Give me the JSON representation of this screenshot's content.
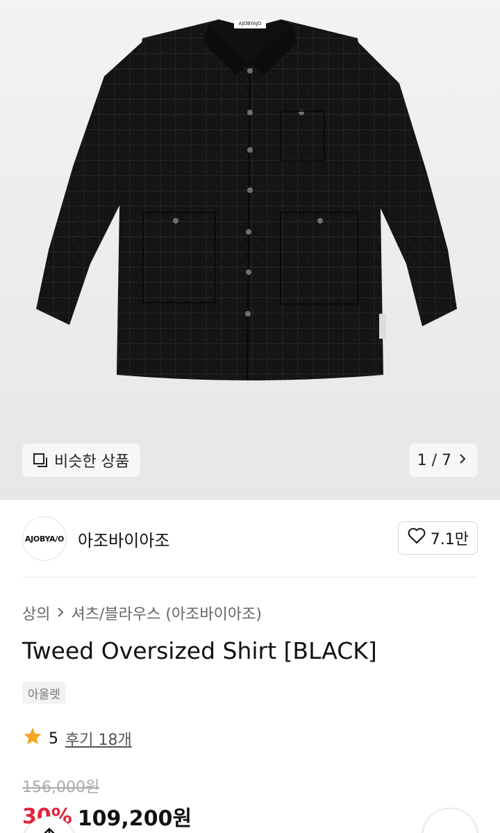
{
  "gallery": {
    "shirt_label": "AJOBYAJO",
    "similar_label": "비슷한 상품",
    "counter": "1 / 7",
    "current": 1,
    "total": 7
  },
  "brand": {
    "logo_text": "AJOBYA/O",
    "name": "아조바이아조",
    "likes": "7.1만"
  },
  "breadcrumb": {
    "category": "상의",
    "subcategory": "셔츠/블라우스 (아조바이아조)"
  },
  "product": {
    "title": "Tweed Oversized Shirt [BLACK]",
    "tag": "아울렛",
    "rating": "5",
    "reviews": "후기 18개",
    "original_price": "156,000원",
    "discount": "30%",
    "sale_price": "109,200원"
  },
  "colors": {
    "discount": "#e0243a",
    "shirt": "#141414",
    "star": "#f5a623"
  }
}
